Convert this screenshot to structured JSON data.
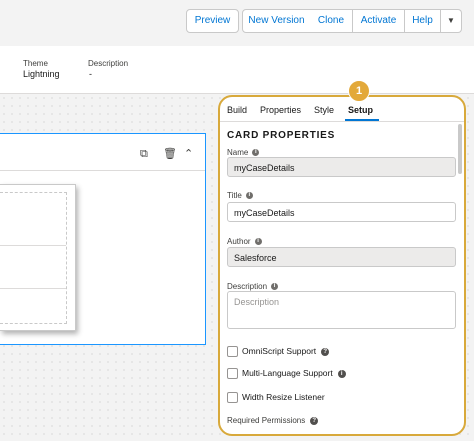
{
  "toolbar": {
    "preview": "Preview",
    "new_version": "New Version",
    "clone": "Clone",
    "activate": "Activate",
    "help": "Help",
    "dropdown_icon": "chevron-down-icon"
  },
  "info": {
    "theme_label": "Theme",
    "theme_value": "Lightning",
    "description_label": "Description",
    "description_value": "-"
  },
  "callout_number": "1",
  "panel": {
    "tabs": [
      {
        "label": "Build"
      },
      {
        "label": "Properties"
      },
      {
        "label": "Style"
      },
      {
        "label": "Setup"
      }
    ],
    "active_tab": "Setup",
    "section_title": "CARD PROPERTIES",
    "fields": {
      "name_label": "Name",
      "name_value": "myCaseDetails",
      "title_label": "Title",
      "title_value": "myCaseDetails",
      "author_label": "Author",
      "author_value": "Salesforce",
      "description_label": "Description",
      "description_placeholder": "Description"
    },
    "checkboxes": [
      {
        "label": "OmniScript Support",
        "checked": false
      },
      {
        "label": "Multi-Language Support",
        "checked": false
      },
      {
        "label": "Width Resize Listener",
        "checked": false
      }
    ],
    "required_permissions_label": "Required Permissions"
  },
  "colors": {
    "accent": "#0176d3",
    "highlight_border": "#d8a93b",
    "selection_border": "#1b96ff"
  }
}
